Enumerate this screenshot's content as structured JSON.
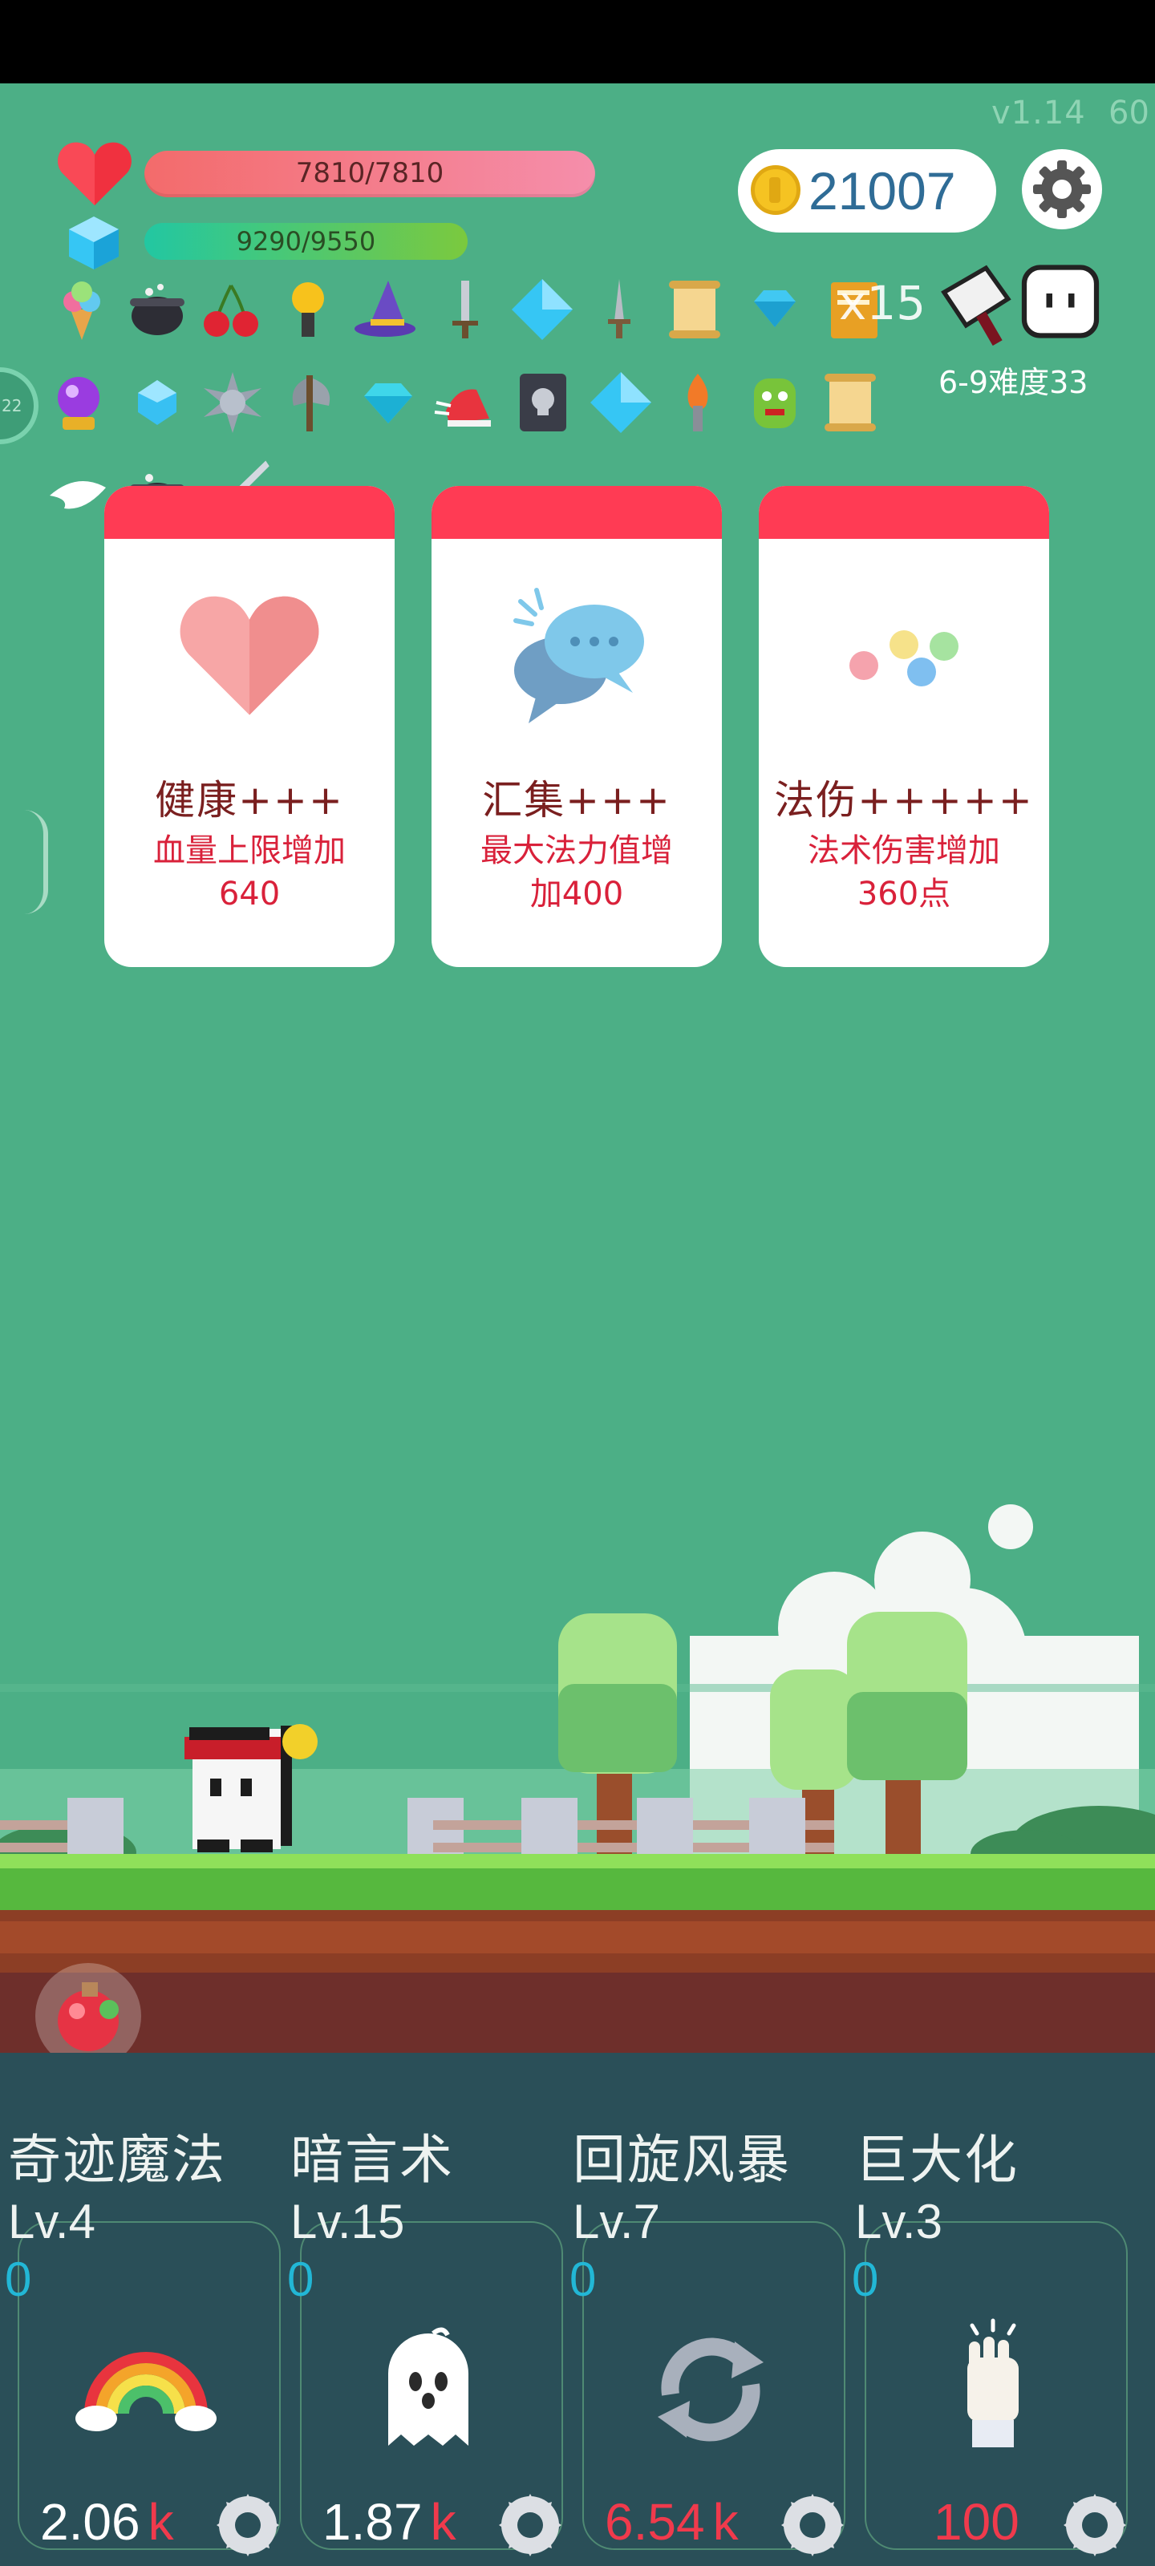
{
  "header": {
    "version": "v1.14",
    "fps": "60"
  },
  "stats": {
    "hp_text": "7810/7810",
    "hp_fill": 1.0,
    "mp_text": "9290/9550",
    "mp_fill": 0.973,
    "coins": "21007"
  },
  "inventory": {
    "items": [
      "ice-cream",
      "cauldron",
      "cherry",
      "torch-trophy",
      "wizard-hat",
      "sword",
      "diamond",
      "dagger",
      "scroll",
      "small-gem",
      "spellbook",
      "crystal-ball",
      "blue-gem",
      "spiked-ball",
      "axe",
      "cyan-gem",
      "winged-shoe",
      "skull-book",
      "diamond",
      "flame-staff",
      "goblin",
      "scroll",
      "angel-wing",
      "cauldron",
      "steel-sword"
    ],
    "multiplier": "x15",
    "boss_label": "6-9难度33"
  },
  "cards": [
    {
      "icon": "heart-icon",
      "title": "健康+++",
      "desc_line1": "血量上限增加",
      "desc_line2": "640"
    },
    {
      "icon": "chat-bubbles-icon",
      "title": "汇集+++",
      "desc_line1": "最大法力值增",
      "desc_line2": "加400"
    },
    {
      "icon": "dots-icon",
      "title": "法伤+++++",
      "desc_line1": "法术伤害增加",
      "desc_line2": "360点"
    }
  ],
  "skills": [
    {
      "name": "奇迹魔法",
      "level": "Lv.4",
      "count": "0",
      "icon": "rainbow-icon",
      "cost": "2.06",
      "unit": "k",
      "affordable": true
    },
    {
      "name": "暗言术",
      "level": "Lv.15",
      "count": "0",
      "icon": "ghost-icon",
      "cost": "1.87",
      "unit": "k",
      "affordable": true
    },
    {
      "name": "回旋风暴",
      "level": "Lv.7",
      "count": "0",
      "icon": "whirlwind-icon",
      "cost": "6.54",
      "unit": "k",
      "affordable": false
    },
    {
      "name": "巨大化",
      "level": "Lv.3",
      "count": "0",
      "icon": "hand-icon",
      "cost": "100",
      "unit": "",
      "affordable": false
    }
  ],
  "colors": {
    "background": "#4caf86",
    "card_header": "#ff3b54",
    "accent_red": "#f03a4c",
    "coin_text": "#2f6c96"
  }
}
